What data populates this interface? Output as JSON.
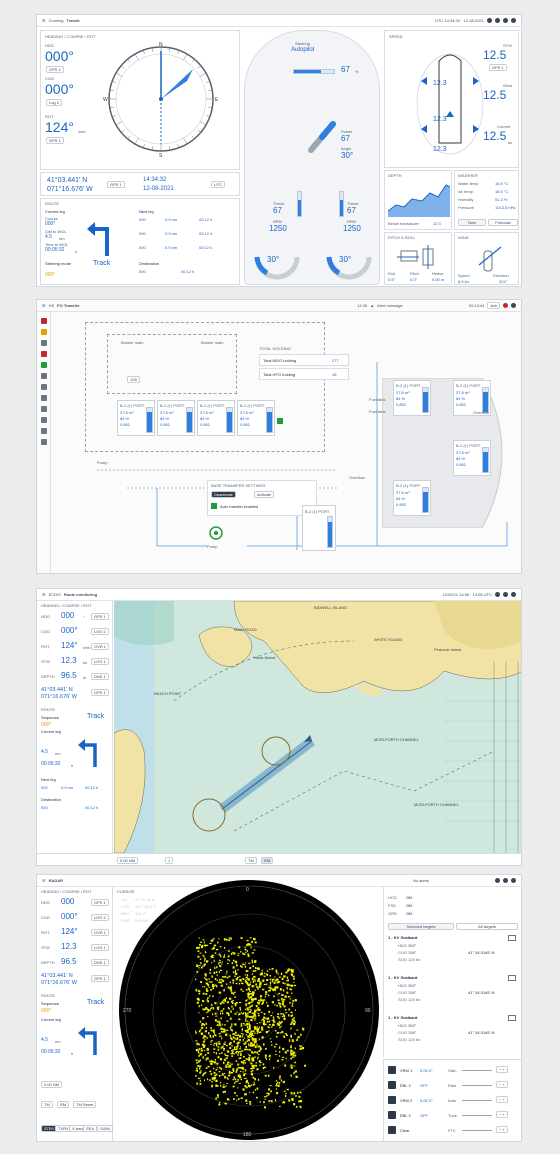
{
  "conning": {
    "breadcrumb": "Conning",
    "title": "Transit",
    "datetime": "UTC 14:34:32 · 12-08-2021",
    "panel_label": "HEADING / COURSE / ROT",
    "hdg_label": "HDG",
    "hdg": "000°",
    "hdg_src": "GPS 1",
    "cog_label": "COG",
    "cog": "000°",
    "cog_src": "Log 2",
    "rot_label": "ROT",
    "rot": "124°",
    "rot_unit": "/min",
    "rot_src": "GPS 1",
    "compass_n": "N",
    "compass_e": "E",
    "compass_s": "S",
    "compass_w": "W",
    "lat": "41°03.441' N",
    "lon": "071°16.676' W",
    "pos_src": "GPS 1",
    "time": "14:34:32",
    "date": "12-08-2021",
    "tz": "UTC",
    "steering_label": "Steering",
    "steering_mode": "Autopilot",
    "rudder_val": "67",
    "rudder_unit": "%",
    "power_label": "Power",
    "power_val": "67",
    "angle_label": "Angle",
    "angle_val": "30°",
    "thrust_left_label": "Thrust",
    "thrust_left": "67",
    "rpm_left_label": "RPM",
    "rpm_left": "1250",
    "thrust_right_label": "Thrust",
    "thrust_right": "67",
    "rpm_right_label": "RPM",
    "rpm_right": "1250",
    "azi_left": "30°",
    "azi_right": "30°",
    "speed_label": "SPEED",
    "stw_label": "STW",
    "stw": "12.5",
    "wind_label": "Wind",
    "wind": "12.5",
    "current_label": "Current",
    "current": "12.5",
    "speed_unit": "kn",
    "hull_top": "12.3",
    "hull_mid": "12.3",
    "hull_bot": "12.3",
    "depth_label": "DEPTH",
    "depth_value": "12.3",
    "depth_unit": "m",
    "depth_src": "Below transducer",
    "weather_label": "WEATHER",
    "weather_rows": [
      {
        "k": "Water temp",
        "v": "16.5 °C"
      },
      {
        "k": "Air temp",
        "v": "18.5 °C"
      },
      {
        "k": "Humidity",
        "v": "51.3 %"
      },
      {
        "k": "Pressure",
        "v": "1013.5 hPa"
      }
    ],
    "weather_tab_now": "Now",
    "weather_tab_forecast": "Forecast",
    "roll_label": "PITCH & ROLL",
    "roll_vals": [
      {
        "k": "Roll",
        "v": "0.5°"
      },
      {
        "k": "Pitch",
        "v": "0.0°"
      },
      {
        "k": "Heave",
        "v": "0.00 m"
      }
    ],
    "wind2_label": "WIND",
    "wind_speed_label": "Speed",
    "wind_speed": "8.5 kn",
    "wind_dir_label": "Direction",
    "wind_dir": "024°",
    "route_label": "ROUTE",
    "current_leg": "Current leg",
    "course_label": "Course",
    "course": "000°",
    "dist_label": "Dist to WOL",
    "dist": "4.5",
    "dist_unit": "nm",
    "tto_label": "Time to WOL",
    "tto": "00:05:32",
    "tto_unit": "h",
    "next_leg": "Next leg",
    "next_rows": [
      {
        "a": "000",
        "b": "0.9 nm",
        "c": "00:12 h"
      },
      {
        "a": "000",
        "b": "0.9 nm",
        "c": "00:12 h"
      },
      {
        "a": "000",
        "b": "0.9 nm",
        "c": "00:12 h"
      }
    ],
    "steering_mode_label": "Steering mode",
    "steering_mode_value": "Track",
    "destination_label": "Destination",
    "destination_value": "000",
    "destination_eta": "00:12 h",
    "course_bottom": "000°"
  },
  "pms": {
    "breadcrumb": "HS",
    "title": "FO Transfer",
    "time": "14:30",
    "alert": "Alert message",
    "alert_time": "00:13:44",
    "ack": "Ack",
    "total_label": "TOTAL HOLDING",
    "mgo_label": "Total MGO holding",
    "mgo": "277",
    "hfo_label": "Total HFO holding",
    "hfo": "18",
    "bunker_main": "Bunker main",
    "tank_label": "B-2 (1) PORT",
    "tank_vals": [
      "27.8 m³",
      "84 %",
      "0.852"
    ],
    "fuel_tank_1": "Fuel tank",
    "fuel_tank_2": "Fuel tank",
    "overflow": "Overflow",
    "transfer_label": "BASE TRANSFER SETTINGS",
    "deactivate": "Deactivate",
    "activate": "Activate",
    "auto_transfer": "Auto transfer enabled",
    "pump_label": "Pump",
    "valve_val": "128"
  },
  "ecdis": {
    "breadcrumb": "ECDIS",
    "title": "Route monitoring",
    "datetime": "12/02/21 14:56 · 14:56 UTC",
    "panel_label": "HEADING / COURSE / ROT",
    "rows": [
      {
        "k": "HDG",
        "v": "000",
        "u": "°",
        "s": "GPS 1"
      },
      {
        "k": "COG",
        "v": "000°",
        "u": "",
        "s": "LOG 2"
      },
      {
        "k": "ROT",
        "v": "124°",
        "u": "/min",
        "s": "GVR 1"
      },
      {
        "k": "STW",
        "v": "12.3",
        "u": "kn",
        "s": "LOG 1"
      },
      {
        "k": "DEPTH",
        "v": "96.5",
        "u": "m",
        "s": "DNS 1"
      }
    ],
    "lat": "41°03.441' N",
    "lon": "071°16.676' W",
    "pos_src": "GPS 1",
    "route_label": "ROUTE",
    "sequence": "Sequence",
    "mode": "Track",
    "course": "000°",
    "current_leg": "Current leg",
    "dist": "4.5",
    "dist_unit": "nm",
    "tto": "00:05:32",
    "tto_unit": "h",
    "next_leg": "Next leg",
    "next_row": {
      "a": "000",
      "b": "0.9 nm",
      "c": "00:12 h"
    },
    "destination_label": "Destination",
    "destination_value": "000",
    "destination_eta": "00:12 h",
    "places": [
      "BIDWELL ISLAND",
      "WHITE ISLAND",
      "MAIN ROAD",
      "Hook Island",
      "Peacock Island",
      "BEACH POINT",
      "MCELFORTH CHANNEL",
      "MCELFORTH CHANNEL"
    ],
    "scale": "0.00 NM",
    "mode_buttons": [
      "TM",
      "RM"
    ],
    "zoom": "1"
  },
  "radar": {
    "breadcrumb": "RADAR",
    "panel_label": "HEADING / COURSE / ROT",
    "rows": [
      {
        "k": "HDG",
        "v": "000",
        "s": "GPS 1"
      },
      {
        "k": "COG",
        "v": "000°",
        "s": "LOG 2"
      },
      {
        "k": "ROT",
        "v": "124°",
        "s": "GVR 1"
      },
      {
        "k": "STW",
        "v": "12.3",
        "s": "LOG 1"
      },
      {
        "k": "DEPTH",
        "v": "96.5",
        "s": "DNS 1"
      }
    ],
    "lat": "41°03.441' N",
    "lon": "071°16.676' W",
    "pos_src": "GPS 1",
    "route_label": "ROUTE",
    "sequence": "Sequence",
    "mode": "Track",
    "course": "000°",
    "current_leg": "Current leg",
    "dist": "4.5",
    "dist_unit": "nm",
    "tto": "00:05:32",
    "tto_unit": "h",
    "cursor_label": "CURSOR",
    "cursor_rows": [
      {
        "k": "LAT",
        "v": "41° 22.6' N"
      },
      {
        "k": "LON",
        "v": "143° 45.2' E"
      },
      {
        "k": "BRG",
        "v": "101.2°"
      },
      {
        "k": "RNG",
        "v": "0.8 NM"
      }
    ],
    "no_alerts": "No alerts",
    "status_rows": [
      {
        "k": "HCD",
        "v": "ON"
      },
      {
        "k": "FSD",
        "v": "ON"
      },
      {
        "k": "GRD",
        "v": "ON"
      }
    ],
    "tabs": [
      "Selected targets",
      "All targets"
    ],
    "targets": [
      {
        "name": "1 - KV Svalbard",
        "rows": [
          "HDG 358°",
          "COG 358°",
          "SOG 125 kn"
        ]
      },
      {
        "name": "1 - KV Svalbard",
        "rows": [
          "HDG 358°",
          "COG 358°",
          "SOG 125 kn"
        ]
      },
      {
        "name": "1 - KV Svalbard",
        "rows": [
          "HDG 358°",
          "COG 358°",
          "SOG 125 kn"
        ]
      }
    ],
    "target_pos": "41° 34.0145' N",
    "range_label": "0.00 NM",
    "mode_btns": [
      "TM",
      "RM",
      "TM Reset"
    ],
    "bottom_btns": [
      "STBY",
      "TXRX",
      "X-band",
      "SEA",
      "GAIN"
    ],
    "ctl_rows": [
      {
        "k": "VRM 1",
        "v": "0.00.0°",
        "t": "Gain"
      },
      {
        "k": "EBL 2",
        "v": "OFF",
        "t": "Rain"
      },
      {
        "k": "VRM 2",
        "v": "0.00.0°",
        "t": "Auto"
      },
      {
        "k": "EBL 2",
        "v": "OFF",
        "t": "Tune"
      },
      {
        "k": "Clear",
        "v": "",
        "t": "FTC"
      }
    ],
    "ring_labels": [
      "0",
      "90",
      "180",
      "270"
    ]
  }
}
